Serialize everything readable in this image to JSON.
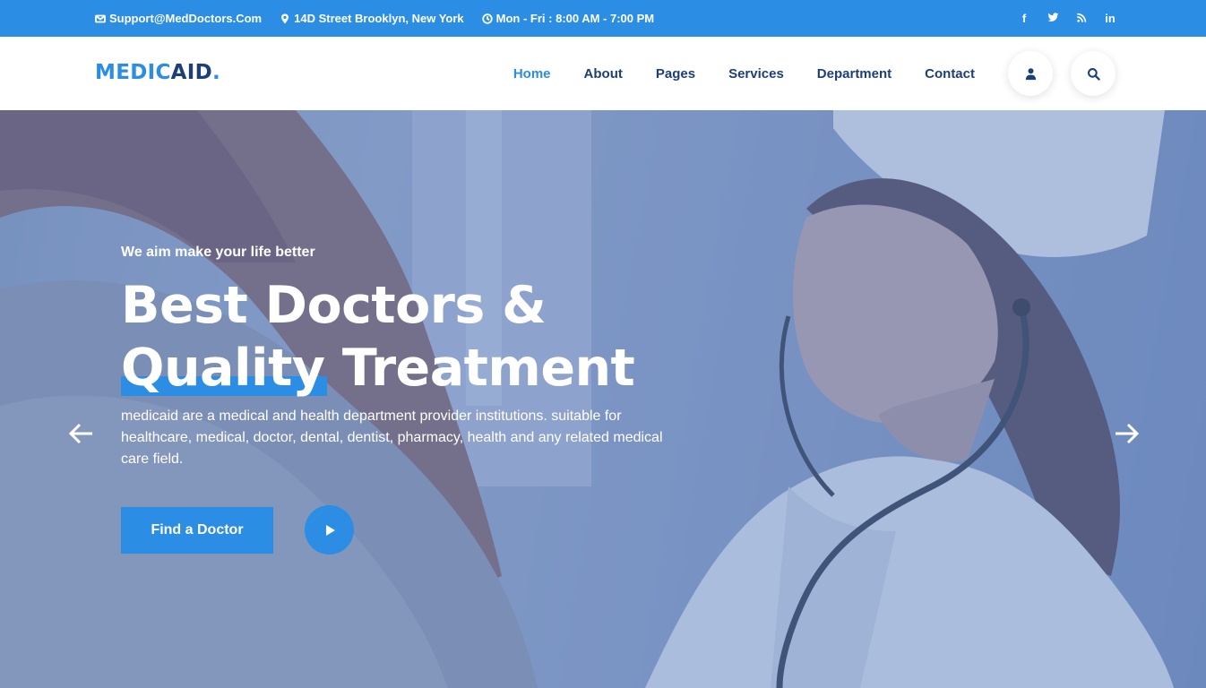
{
  "topbar": {
    "email": "Support@MedDoctors.Com",
    "address": "14D Street Brooklyn, New York",
    "hours": "Mon - Fri : 8:00 AM - 7:00 PM",
    "social": {
      "facebook": "f",
      "linkedin": "in"
    }
  },
  "header": {
    "logo": {
      "part1": "MEDIC",
      "part2": "AID",
      "part3": "."
    },
    "nav": [
      {
        "label": "Home",
        "active": true
      },
      {
        "label": "About"
      },
      {
        "label": "Pages"
      },
      {
        "label": "Services"
      },
      {
        "label": "Department"
      },
      {
        "label": "Contact"
      }
    ]
  },
  "hero": {
    "subtitle": "We aim make your life better",
    "title_line1": "Best Doctors &",
    "title_line2": "Quality Treatment",
    "description": "medicaid are a medical and health department provider institutions. suitable for healthcare, medical, doctor, dental, dentist, pharmacy, health and any related medical care field.",
    "cta_label": "Find a Doctor"
  },
  "colors": {
    "brand": "#2b8de3",
    "navy": "#1c3f7c"
  },
  "icons": [
    "envelope-icon",
    "map-marker-icon",
    "clock-icon",
    "facebook-icon",
    "twitter-icon",
    "rss-icon",
    "linkedin-icon",
    "user-icon",
    "search-icon",
    "play-icon",
    "arrow-left-icon",
    "arrow-right-icon"
  ]
}
